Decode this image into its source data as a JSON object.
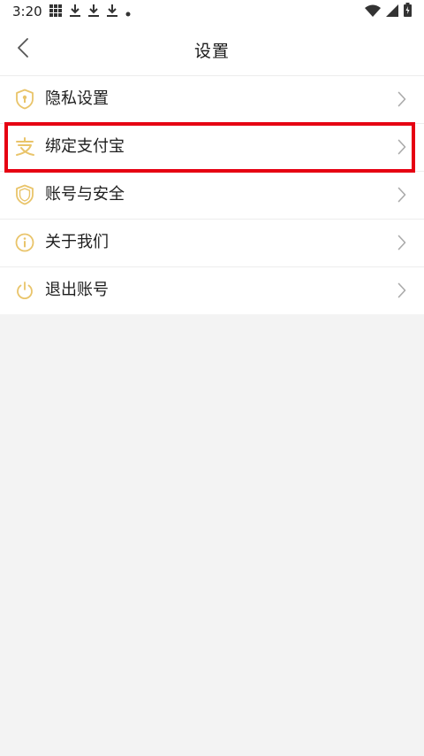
{
  "status_bar": {
    "time": "3:20",
    "left_icons": [
      "grid-icon",
      "download-icon",
      "download-icon",
      "download-icon",
      "dot-icon"
    ],
    "right_icons": [
      "wifi-icon",
      "signal-icon",
      "battery-icon"
    ]
  },
  "header": {
    "title": "设置",
    "back_icon": "chevron-left-icon"
  },
  "menu": {
    "items": [
      {
        "label": "隐私设置",
        "icon": "privacy-shield-icon"
      },
      {
        "label": "绑定支付宝",
        "icon": "alipay-icon"
      },
      {
        "label": "账号与安全",
        "icon": "security-shield-icon"
      },
      {
        "label": "关于我们",
        "icon": "info-icon"
      },
      {
        "label": "退出账号",
        "icon": "power-icon"
      }
    ],
    "chevron_icon": "chevron-right-icon",
    "highlighted_item": "绑定支付宝"
  },
  "colors": {
    "icon_accent": "#e9c46a",
    "highlight_border": "#e60012",
    "background": "#f3f3f3"
  }
}
